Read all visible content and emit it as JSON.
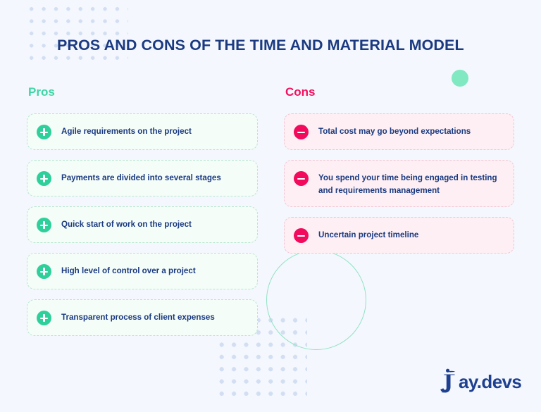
{
  "header": {
    "title": "PROS AND CONS OF THE TIME AND MATERIAL MODEL"
  },
  "columns": {
    "pros": {
      "heading": "Pros",
      "accent_color": "#3ed6a4",
      "badge_icon": "plus-icon",
      "items": [
        {
          "text": "Agile requirements on the project"
        },
        {
          "text": "Payments are divided into several stages"
        },
        {
          "text": "Quick start of work on the project"
        },
        {
          "text": "High level of control over a project"
        },
        {
          "text": "Transparent process of client expenses"
        }
      ]
    },
    "cons": {
      "heading": "Cons",
      "accent_color": "#f4105f",
      "badge_icon": "minus-icon",
      "items": [
        {
          "text": "Total cost may go beyond expectations"
        },
        {
          "text": "You spend your time being engaged in testing and requirements management"
        },
        {
          "text": "Uncertain project timeline"
        }
      ]
    }
  },
  "logo": {
    "text": "ay.devs",
    "mark": "jay-bird-icon",
    "color": "#1e4090"
  },
  "decor": {
    "background_color": "#f4f7fd",
    "dot_color": "#d2def2",
    "ring_color": "#8fe3c3",
    "green_dot_color": "#80e9c1",
    "title_color": "#1b3a80",
    "card_pro_fill": "#f4fdf8",
    "card_pro_border": "#b6e6cf",
    "card_con_fill": "#fdeff3",
    "card_con_border": "#f0c6d4",
    "badge_pro_color": "#2fcf9b",
    "badge_con_color": "#f20a5c"
  }
}
